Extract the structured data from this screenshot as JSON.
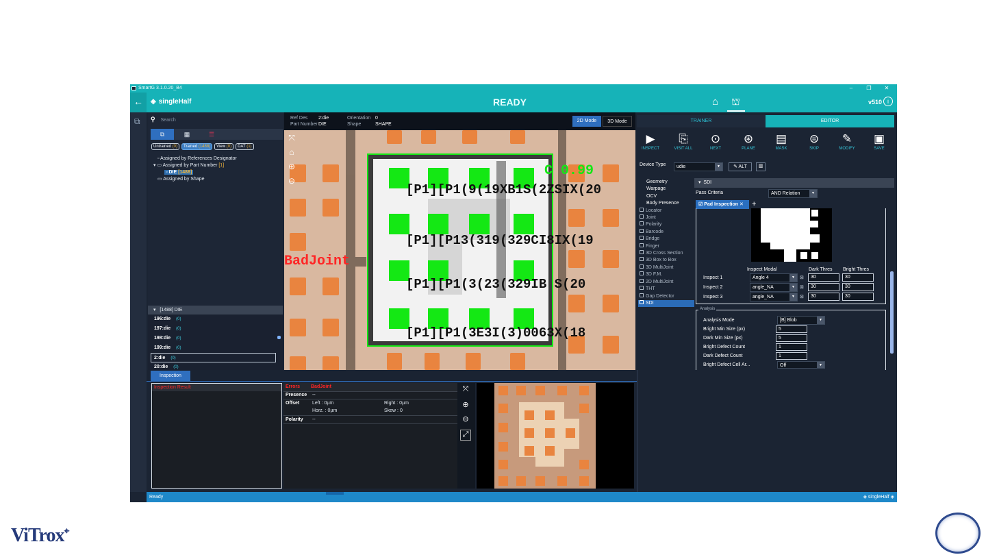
{
  "app": {
    "window_title": "SmartG 3.1.0.20_B4",
    "project_name": "singleHalf",
    "status": "READY",
    "version": "v510",
    "statusbar_text": "Ready",
    "statusbar_project": "singleHalf"
  },
  "left_panel": {
    "search_placeholder": "Search",
    "filters": [
      {
        "label": "Untrained",
        "count": "(0)"
      },
      {
        "label": "Trained",
        "count": "(1488)"
      },
      {
        "label": "View",
        "count": "(0)"
      },
      {
        "label": "DAT",
        "count": "(1)"
      }
    ],
    "tree": {
      "by_ref": "Assigned by References Designator",
      "by_part": "Assigned by Part Number",
      "by_part_count": "[1]",
      "die_label": "DIE",
      "die_count": "[1488]",
      "by_shape": "Assigned by Shape"
    },
    "die_list": {
      "header": "[1488] DIE",
      "rows": [
        {
          "name": "196:die",
          "count": "(0)"
        },
        {
          "name": "197:die",
          "count": "(0)"
        },
        {
          "name": "198:die",
          "count": "(0)"
        },
        {
          "name": "199:die",
          "count": "(0)"
        },
        {
          "name": "2:die",
          "count": "(0)"
        },
        {
          "name": "20:die",
          "count": "(0)"
        }
      ]
    }
  },
  "image_info": {
    "ref_des_label": "Ref Des",
    "ref_des_value": "2:die",
    "part_number_label": "Part Number",
    "part_number_value": "DIE",
    "orientation_label": "Orientation",
    "orientation_value": "0",
    "shape_label": "Shape",
    "shape_value": "SHAPE",
    "mode_2d": "2D Mode",
    "mode_3d": "3D Mode"
  },
  "overlay": {
    "score": "0.99",
    "badjoint": "BadJoint",
    "row1": "[P1][P1(9(19XB1S(2ZSIX(20",
    "row2": "[P1][P13(319(329CI8IX(19",
    "row3": "[P1][P1(3(23(329IB S(20",
    "row4": "[P1][P1(3E3I(3)0063X(18"
  },
  "editor": {
    "tab_trainer": "TRAINER",
    "tab_editor": "EDITOR",
    "toolbar": [
      {
        "label": "INSPECT",
        "icon": "play-icon"
      },
      {
        "label": "VISIT ALL",
        "icon": "visit-all-icon"
      },
      {
        "label": "NEXT",
        "icon": "next-icon"
      },
      {
        "label": "PLANE",
        "icon": "plane-icon"
      },
      {
        "label": "MASK",
        "icon": "mask-icon"
      },
      {
        "label": "SKIP",
        "icon": "skip-icon"
      },
      {
        "label": "MODIFY",
        "icon": "modify-icon"
      },
      {
        "label": "SAVE",
        "icon": "save-icon"
      }
    ],
    "device_type_label": "Device Type",
    "device_type_value": "udie",
    "alt_label": "ALT",
    "algorithms": [
      {
        "label": "Geometry",
        "type": "header"
      },
      {
        "label": "Warpage",
        "type": "header"
      },
      {
        "label": "OCV",
        "type": "header"
      },
      {
        "label": "Body Presence",
        "type": "header"
      },
      {
        "label": "Locator",
        "type": "check"
      },
      {
        "label": "Joint",
        "type": "check"
      },
      {
        "label": "Polarity",
        "type": "check"
      },
      {
        "label": "Barcode",
        "type": "check"
      },
      {
        "label": "Bridge",
        "type": "check"
      },
      {
        "label": "Finger",
        "type": "check"
      },
      {
        "label": "3D Cross Section",
        "type": "check"
      },
      {
        "label": "3D Box to Box",
        "type": "check"
      },
      {
        "label": "3D MultiJoint",
        "type": "check"
      },
      {
        "label": "3D F.M.",
        "type": "check"
      },
      {
        "label": "2D MultiJoint",
        "type": "check"
      },
      {
        "label": "THT",
        "type": "check"
      },
      {
        "label": "Gap Detector",
        "type": "check"
      },
      {
        "label": "SDI",
        "type": "selected"
      }
    ],
    "sdi_header": "SDI",
    "pass_criteria_label": "Pass Criteria",
    "pass_criteria_value": "AND Relation",
    "pad_tab": "Pad Inspection",
    "col_modal": "Inspect Modal",
    "col_dark": "Dark Thres",
    "col_bright": "Bright Thres",
    "inspects": [
      {
        "label": "Inspect 1",
        "modal": "Angle 4",
        "dark": "30",
        "bright": "30"
      },
      {
        "label": "Inspect 2",
        "modal": "angle_NA",
        "dark": "30",
        "bright": "30"
      },
      {
        "label": "Inspect 3",
        "modal": "angle_NA",
        "dark": "30",
        "bright": "30"
      }
    ],
    "analysis_title": "Analysis",
    "analysis_mode_label": "Analysis Mode",
    "analysis_mode_value": "[B] Blob",
    "params": [
      {
        "label": "Bright Min Size (px)",
        "value": "5"
      },
      {
        "label": "Dark Min Size (px)",
        "value": "5"
      },
      {
        "label": "Bright Defect Count",
        "value": "1"
      },
      {
        "label": "Dark Defect Count",
        "value": "1"
      },
      {
        "label": "Bright Defect Cell Ar...",
        "value": "Off"
      }
    ]
  },
  "inspection_panel": {
    "tab": "Inspection",
    "result_header": "Inspection Result",
    "errors_label": "Errors",
    "errors_value": "BadJoint",
    "presence_label": "Presence",
    "presence_value": "--",
    "offset_label": "Offset",
    "offset_left": "Left : 0µm",
    "offset_right": "Right : 0µm",
    "offset_horz": "Horz. : 0µm",
    "offset_skew": "Skew : 0",
    "polarity_label": "Polarity",
    "polarity_value": "--"
  },
  "branding": {
    "logo": "ViTrox"
  },
  "colors": {
    "accent": "#16b3b8",
    "green": "#14e814",
    "error": "#ff2525",
    "pad": "#e9843f"
  }
}
